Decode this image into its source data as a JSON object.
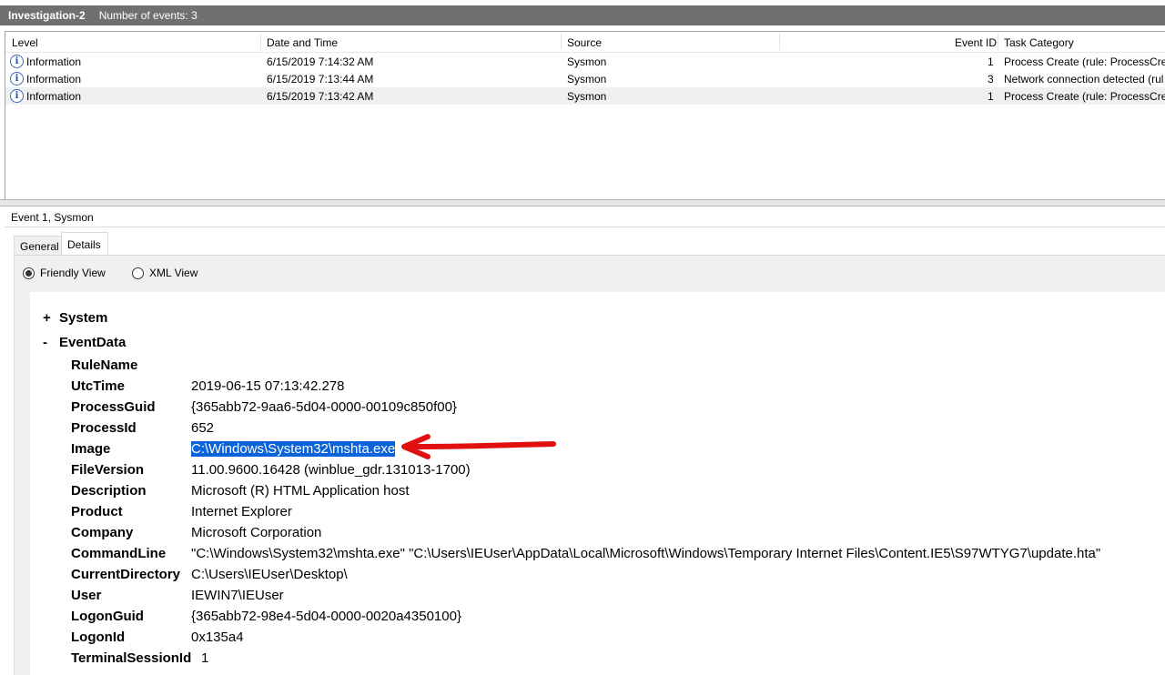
{
  "titlebar": {
    "name": "Investigation-2",
    "count": "Number of events: 3"
  },
  "events": {
    "columns": [
      "Level",
      "Date and Time",
      "Source",
      "Event ID",
      "Task Category"
    ],
    "rows": [
      {
        "level": "Information",
        "date": "6/15/2019 7:14:32 AM",
        "source": "Sysmon",
        "id": "1",
        "category": "Process Create (rule: ProcessCreat"
      },
      {
        "level": "Information",
        "date": "6/15/2019 7:13:44 AM",
        "source": "Sysmon",
        "id": "3",
        "category": "Network connection detected (rul"
      },
      {
        "level": "Information",
        "date": "6/15/2019 7:13:42 AM",
        "source": "Sysmon",
        "id": "1",
        "category": "Process Create (rule: ProcessCreat"
      }
    ],
    "info_icon": "information-icon",
    "selected_row": 3
  },
  "detail": {
    "title": "Event 1, Sysmon",
    "tabs": [
      "General",
      "Details"
    ],
    "active_tab": "Details",
    "views": [
      "Friendly View",
      "XML View"
    ],
    "selected_view": "Friendly View",
    "system": {
      "toggle": "+",
      "label": "System"
    },
    "eventdata": {
      "toggle": "-",
      "label": "EventData"
    },
    "fields": [
      {
        "name": "RuleName",
        "value": ""
      },
      {
        "name": "UtcTime",
        "value": "2019-06-15 07:13:42.278"
      },
      {
        "name": "ProcessGuid",
        "value": "{365abb72-9aa6-5d04-0000-00109c850f00}"
      },
      {
        "name": "ProcessId",
        "value": "652"
      },
      {
        "name": "Image",
        "value": "C:\\Windows\\System32\\mshta.exe"
      },
      {
        "name": "FileVersion",
        "value": "11.00.9600.16428 (winblue_gdr.131013-1700)"
      },
      {
        "name": "Description",
        "value": "Microsoft (R) HTML Application host"
      },
      {
        "name": "Product",
        "value": "Internet Explorer"
      },
      {
        "name": "Company",
        "value": "Microsoft Corporation"
      },
      {
        "name": "CommandLine",
        "value": "\"C:\\Windows\\System32\\mshta.exe\" \"C:\\Users\\IEUser\\AppData\\Local\\Microsoft\\Windows\\Temporary Internet Files\\Content.IE5\\S97WTYG7\\update.hta\""
      },
      {
        "name": "CurrentDirectory",
        "value": "C:\\Users\\IEUser\\Desktop\\"
      },
      {
        "name": "User",
        "value": "IEWIN7\\IEUser"
      },
      {
        "name": "LogonGuid",
        "value": "{365abb72-98e4-5d04-0000-0020a4350100}"
      },
      {
        "name": "LogonId",
        "value": "0x135a4"
      },
      {
        "name": "TerminalSessionId",
        "value": "1"
      }
    ],
    "highlighted_field": "Image",
    "annotation": {
      "type": "red-arrow",
      "color": "#e01010",
      "points_to": "Image"
    }
  }
}
